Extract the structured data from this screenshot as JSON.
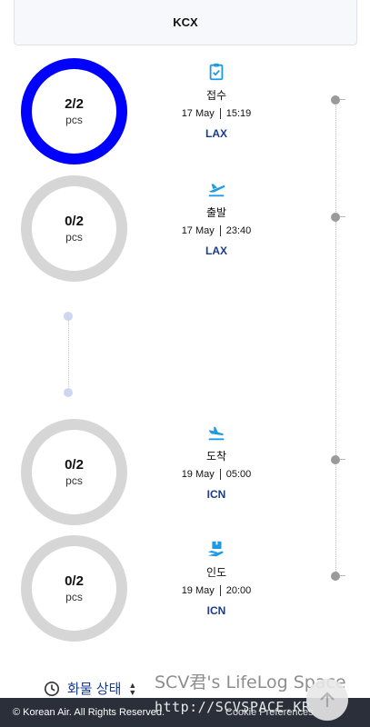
{
  "header": {
    "code": "KCX"
  },
  "steps": [
    {
      "count": "2/2",
      "unit": "pcs",
      "title": "접수",
      "date": "17 May",
      "time": "15:19",
      "place": "LAX",
      "icon": "clipboard-check-icon",
      "active": true
    },
    {
      "count": "0/2",
      "unit": "pcs",
      "title": "출발",
      "date": "17 May",
      "time": "23:40",
      "place": "LAX",
      "icon": "plane-departure-icon",
      "active": false
    },
    {
      "count": "0/2",
      "unit": "pcs",
      "title": "도착",
      "date": "19 May",
      "time": "05:00",
      "place": "ICN",
      "icon": "plane-arrival-icon",
      "active": false
    },
    {
      "count": "0/2",
      "unit": "pcs",
      "title": "인도",
      "date": "19 May",
      "time": "20:00",
      "place": "ICN",
      "icon": "package-hand-icon",
      "active": false
    }
  ],
  "status": {
    "label": "화물 상태"
  },
  "footer": {
    "copyright": "© Korean Air. All Rights Reserved.",
    "cookie": "Cookie Preferences"
  },
  "watermark": {
    "line1": "SCV君's LifeLog Space",
    "line2": "http://SCVSPACE.KR"
  },
  "colors": {
    "active_ring": "#0000ff",
    "inactive_ring": "#d6d6d6",
    "link": "#1a3c8c",
    "icon": "#1e9be0"
  }
}
